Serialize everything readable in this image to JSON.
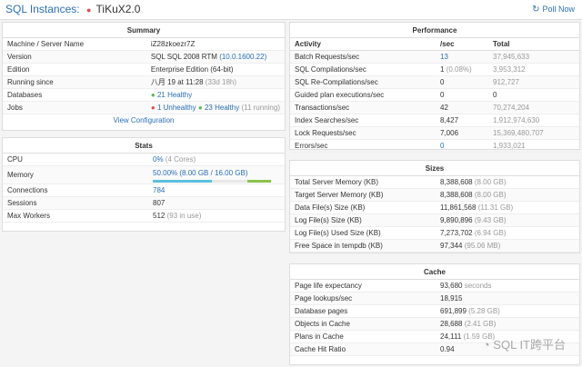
{
  "header": {
    "crumb_link": "SQL Instances:",
    "instance": "TiKuX2.0",
    "poll_label": "Poll Now"
  },
  "summary": {
    "title": "Summary",
    "rows": [
      {
        "label": "Machine / Server Name",
        "value": "iZ28zkoezr7Z"
      },
      {
        "label": "Version",
        "value": "SQL SQL 2008 RTM",
        "extra": "(10.0.1600.22)"
      },
      {
        "label": "Edition",
        "value": "Enterprise Edition (64-bit)"
      },
      {
        "label": "Running since",
        "value": "八月 19 at 11:28",
        "extra": "(33d 18h)"
      },
      {
        "label": "Databases",
        "value": "21 Healthy"
      },
      {
        "label": "Jobs",
        "value": "1 Unhealthy",
        "value2": "23 Healthy",
        "extra": "(11 running)"
      }
    ],
    "footer_link": "View Configuration"
  },
  "stats": {
    "title": "Stats",
    "cpu_label": "CPU",
    "cpu_value": "0%",
    "cpu_extra": "(4 Cores)",
    "memory_label": "Memory",
    "memory_value": "50.00% (8.00 GB / 16.00 GB)",
    "memory_fraction": 0.5,
    "connections_label": "Connections",
    "connections_value": "784",
    "sessions_label": "Sessions",
    "sessions_value": "807",
    "maxworkers_label": "Max Workers",
    "maxworkers_value": "512",
    "maxworkers_extra": "(93 in use)"
  },
  "performance": {
    "title": "Performance",
    "headers": [
      "Activity",
      "/sec",
      "Total"
    ],
    "rows": [
      {
        "activity": "Batch Requests/sec",
        "sec": "13",
        "total": "37,945,633"
      },
      {
        "activity": "SQL Compilations/sec",
        "sec": "1",
        "sec_extra": "(0.08%)",
        "total": "3,953,312"
      },
      {
        "activity": "SQL Re-Compilations/sec",
        "sec": "0",
        "total": "912,727"
      },
      {
        "activity": "Guided plan executions/sec",
        "sec": "0",
        "total": "0"
      },
      {
        "activity": "Transactions/sec",
        "sec": "42",
        "total": "70,274,204"
      },
      {
        "activity": "Index Searches/sec",
        "sec": "8,427",
        "total": "1,912,974,630"
      },
      {
        "activity": "Lock Requests/sec",
        "sec": "7,006",
        "total": "15,369,480,707"
      },
      {
        "activity": "Errors/sec",
        "sec": "0",
        "total": "1,933,021"
      }
    ]
  },
  "sizes": {
    "title": "Sizes",
    "rows": [
      {
        "label": "Total Server Memory (KB)",
        "value": "8,388,608",
        "extra": "(8.00 GB)"
      },
      {
        "label": "Target Server Memory (KB)",
        "value": "8,388,608",
        "extra": "(8.00 GB)"
      },
      {
        "label": "Data File(s) Size (KB)",
        "value": "11,861,568",
        "extra": "(11.31 GB)"
      },
      {
        "label": "Log File(s) Size (KB)",
        "value": "9,890,896",
        "extra": "(9.43 GB)"
      },
      {
        "label": "Log File(s) Used Size (KB)",
        "value": "7,273,702",
        "extra": "(6.94 GB)"
      },
      {
        "label": "Free Space in tempdb (KB)",
        "value": "97,344",
        "extra": "(95.06 MB)"
      }
    ]
  },
  "cache": {
    "title": "Cache",
    "rows": [
      {
        "label": "Page life expectancy",
        "value": "93,680",
        "extra": "seconds"
      },
      {
        "label": "Page lookups/sec",
        "value": "18,915",
        "extra": ""
      },
      {
        "label": "Database pages",
        "value": "691,899",
        "extra": "(5.28 GB)"
      },
      {
        "label": "Objects in Cache",
        "value": "28,688",
        "extra": "(2.41 GB)"
      },
      {
        "label": "Plans in Cache",
        "value": "24,111",
        "extra": "(1.59 GB)"
      },
      {
        "label": "Cache Hit Ratio",
        "value": "0.94",
        "extra": ""
      }
    ]
  },
  "watermark": "SQL IT跨平台"
}
